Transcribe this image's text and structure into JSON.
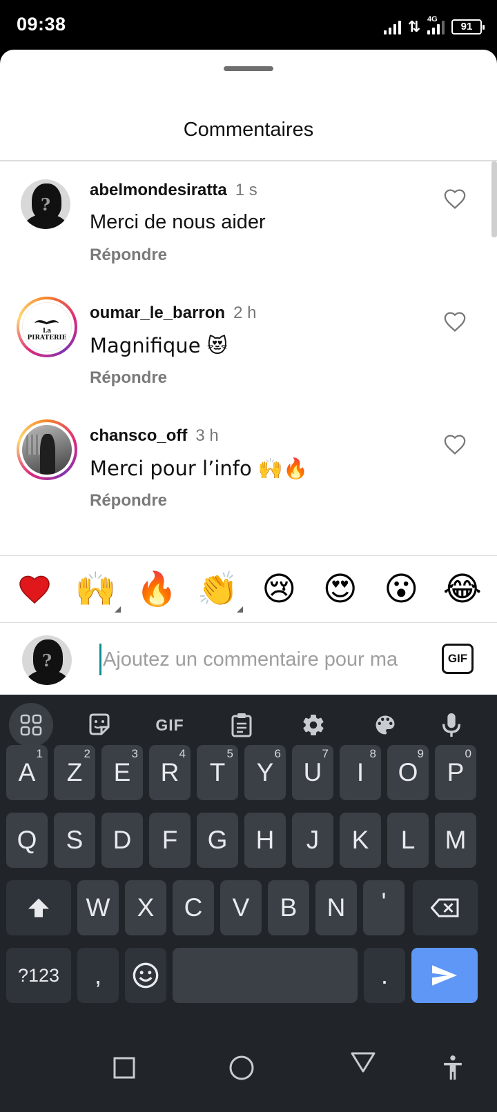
{
  "status_bar": {
    "time": "09:38",
    "network": "4G",
    "battery": "91"
  },
  "sheet": {
    "title": "Commentaires",
    "comments": [
      {
        "username": "abelmondesiratta",
        "time": "1 s",
        "text": "Merci de nous aider",
        "reply": "Répondre",
        "avatar": "silhouette-question-avatar"
      },
      {
        "username": "oumar_le_barron",
        "time": "2 h",
        "text": "Magnifique 😻",
        "reply": "Répondre",
        "avatar": "la-piraterie-logo-avatar",
        "avatar_text": "La PIRATERIE"
      },
      {
        "username": "chansco_off",
        "time": "3 h",
        "text": "Merci pour l’info 🙌🔥",
        "reply": "Répondre",
        "avatar": "person-photo-avatar"
      }
    ]
  },
  "reactions": [
    "❤️",
    "🙌",
    "🔥",
    "👏",
    "😢",
    "😍",
    "😮",
    "😂"
  ],
  "composer": {
    "placeholder": "Ajoutez un commentaire pour ma",
    "gif_label": "GIF"
  },
  "keyboard": {
    "toolbar": {
      "gif_label": "GIF"
    },
    "row1": [
      {
        "k": "A",
        "n": "1"
      },
      {
        "k": "Z",
        "n": "2"
      },
      {
        "k": "E",
        "n": "3"
      },
      {
        "k": "R",
        "n": "4"
      },
      {
        "k": "T",
        "n": "5"
      },
      {
        "k": "Y",
        "n": "6"
      },
      {
        "k": "U",
        "n": "7"
      },
      {
        "k": "I",
        "n": "8"
      },
      {
        "k": "O",
        "n": "9"
      },
      {
        "k": "P",
        "n": "0"
      }
    ],
    "row2": [
      "Q",
      "S",
      "D",
      "F",
      "G",
      "H",
      "J",
      "K",
      "L",
      "M"
    ],
    "row3": [
      "W",
      "X",
      "C",
      "V",
      "B",
      "N",
      "'"
    ],
    "symbols_label": "?123",
    "comma": ",",
    "period": "."
  },
  "colors": {
    "accent_blue": "#5e97f6",
    "keyboard_bg": "#212529",
    "key_bg": "#3b4047",
    "cursor": "#0f8c8c"
  }
}
